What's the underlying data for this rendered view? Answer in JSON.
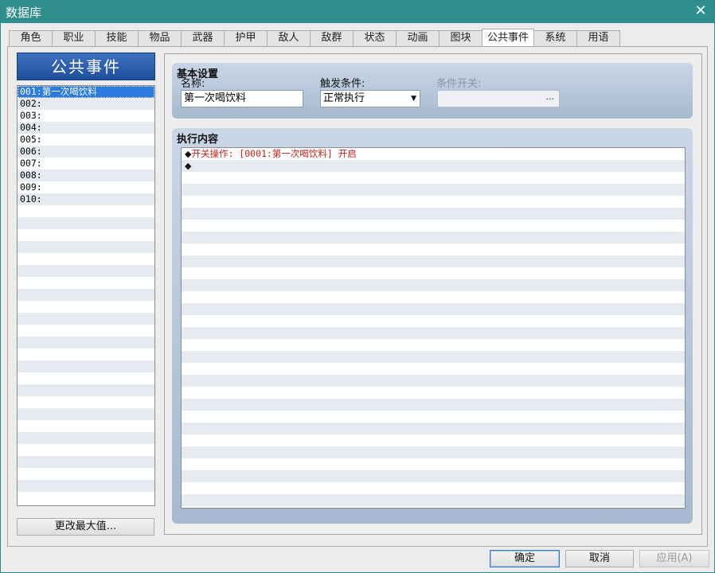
{
  "window": {
    "title": "数据库"
  },
  "tabs": [
    {
      "label": "角色",
      "active": false
    },
    {
      "label": "职业",
      "active": false
    },
    {
      "label": "技能",
      "active": false
    },
    {
      "label": "物品",
      "active": false
    },
    {
      "label": "武器",
      "active": false
    },
    {
      "label": "护甲",
      "active": false
    },
    {
      "label": "敌人",
      "active": false
    },
    {
      "label": "敌群",
      "active": false
    },
    {
      "label": "状态",
      "active": false
    },
    {
      "label": "动画",
      "active": false
    },
    {
      "label": "图块",
      "active": false
    },
    {
      "label": "公共事件",
      "active": true
    },
    {
      "label": "系统",
      "active": false
    },
    {
      "label": "用语",
      "active": false
    }
  ],
  "list": {
    "header": "公共事件",
    "items": [
      "001:第一次喝饮料",
      "002:",
      "003:",
      "004:",
      "005:",
      "006:",
      "007:",
      "008:",
      "009:",
      "010:"
    ],
    "selected_index": 0,
    "change_max_label": "更改最大值..."
  },
  "basic": {
    "title": "基本设置",
    "name_label": "名称:",
    "name_value": "第一次喝饮料",
    "trigger_label": "触发条件:",
    "trigger_value": "正常执行",
    "switch_label": "条件开关:",
    "switch_value": "",
    "switch_button": "..."
  },
  "contents": {
    "title": "执行内容",
    "commands": [
      {
        "mark": "◆",
        "text": "开关操作: [0001:第一次喝饮料] 开启"
      },
      {
        "mark": "◆",
        "text": ""
      }
    ]
  },
  "footer": {
    "ok": "确定",
    "cancel": "取消",
    "apply": "应用(A)"
  },
  "colors": {
    "titlebar": "#2f8f8c",
    "selection": "#2b7be0",
    "command_text": "#c8221c",
    "group_bg": "#b8c8dc"
  }
}
